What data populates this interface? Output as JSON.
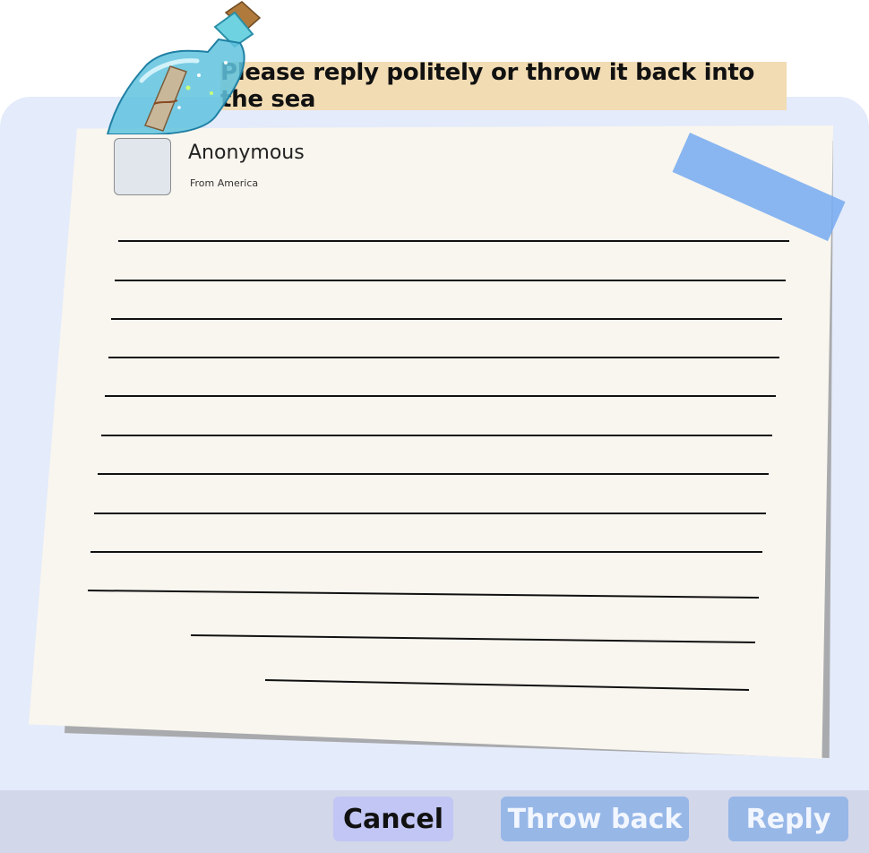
{
  "banner": {
    "title": "Please reply politely or throw it back into the sea"
  },
  "sender": {
    "name": "Anonymous",
    "origin": "From America"
  },
  "letter": {
    "lines_count": 12
  },
  "actions": {
    "cancel_label": "Cancel",
    "throw_back_label": "Throw back",
    "reply_label": "Reply"
  },
  "colors": {
    "panel": "#e4ebfa",
    "paper": "#f9f6ef",
    "banner": "#f2dcb4",
    "tape": "#76aaf0",
    "primary_button": "#97b7e7",
    "cancel_button": "#c2c6f4"
  },
  "icons": {
    "bottle": "message-bottle-icon"
  }
}
